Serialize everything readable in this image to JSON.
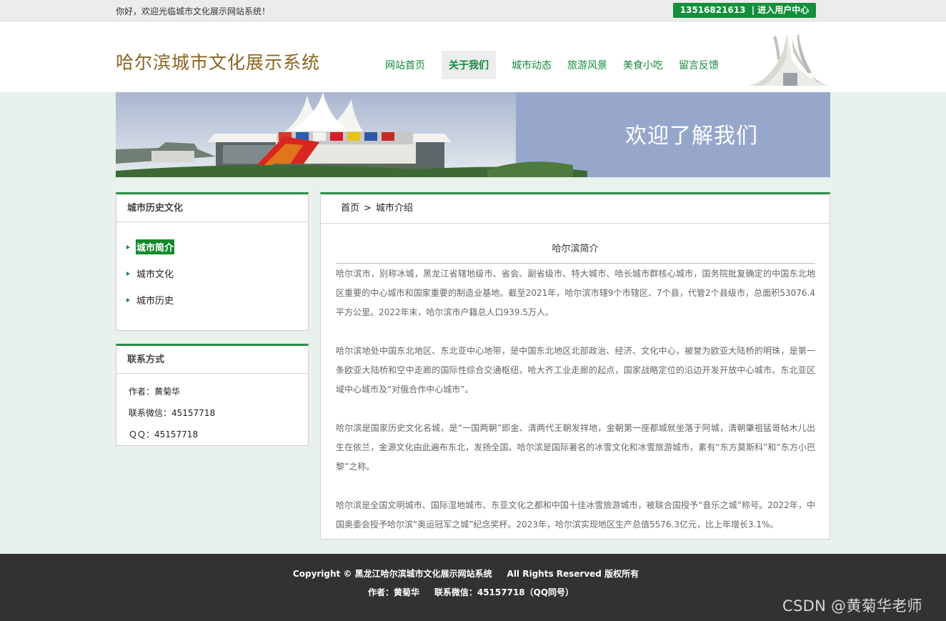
{
  "topbar": {
    "welcome": "你好，欢迎光临城市文化展示网站系统！",
    "phone": "13516821613",
    "user_center": "| 进入用户中心"
  },
  "header": {
    "site_title": "哈尔滨城市文化展示系统",
    "nav": [
      "网站首页",
      "关于我们",
      "城市动态",
      "旅游风景",
      "美食小吃",
      "留言反馈"
    ],
    "active_nav_index": 1
  },
  "banner": {
    "title": "欢迎了解我们"
  },
  "sidebar": {
    "history_box": {
      "title": "城市历史文化",
      "items": [
        "城市简介",
        "城市文化",
        "城市历史"
      ],
      "active_index": 0
    },
    "contact_box": {
      "title": "联系方式",
      "author": "作者：黄菊华",
      "wechat": "联系微信：45157718",
      "qq": "ＱＱ：45157718"
    }
  },
  "main": {
    "breadcrumb": {
      "home": "首页",
      "separator": ">",
      "current": "城市介绍"
    },
    "article_title": "哈尔滨简介",
    "paragraphs": [
      "哈尔滨市，别称冰城，黑龙江省辖地级市、省会、副省级市、特大城市、哈长城市群核心城市，国务院批复确定的中国东北地区重要的中心城市和国家重要的制造业基地。截至2021年，哈尔滨市辖9个市辖区、7个县，代管2个县级市，总面积53076.4平方公里。2022年末，哈尔滨市户籍总人口939.5万人。",
      "哈尔滨地处中国东北地区、东北亚中心地带，是中国东北地区北部政治、经济、文化中心，被誉为欧亚大陆桥的明珠，是第一条欧亚大陆桥和空中走廊的国际性综合交通枢纽，哈大齐工业走廊的起点，国家战略定位的沿边开发开放中心城市、东北亚区域中心城市及“对俄合作中心城市”。",
      "哈尔滨是国家历史文化名城，是“一国两朝”即金、清两代王朝发祥地，金朝第一座都城就坐落于阿城，清朝肇祖猛哥帖木儿出生在依兰，金源文化由此遍布东北，发扬全国。哈尔滨是国际著名的冰雪文化和冰雪旅游城市，素有“东方莫斯科”和“东方小巴黎”之称。",
      "哈尔滨是全国文明城市、国际湿地城市、东亚文化之都和中国十佳冰雪旅游城市，被联合国授予“音乐之城”称号。2022年，中国奥委会授予哈尔滨“奥运冠军之城”纪念奖杯。2023年，哈尔滨实现地区生产总值5576.3亿元，比上年增长3.1%。"
    ]
  },
  "footer": {
    "line1": "Copyright © 黑龙江哈尔滨城市文化展示网站系统     All Rights Reserved 版权所有",
    "line2": "作者：黄菊华     联系微信：45157718（QQ同号）"
  },
  "watermark": "CSDN @黄菊华老师",
  "colors": {
    "accent_green": "#138a3c",
    "title_brown": "#8a6420",
    "page_bg": "#e8f1ec",
    "footer_bg": "#323232",
    "banner_blue": "#97a7cc"
  }
}
